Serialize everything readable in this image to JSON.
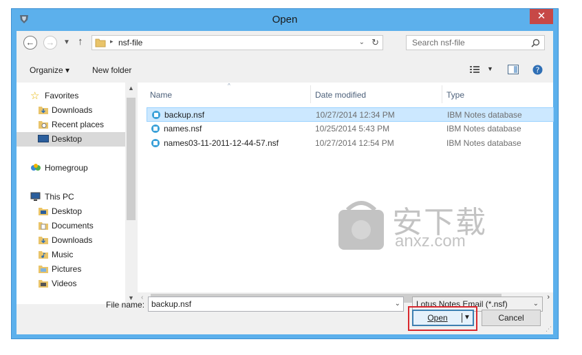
{
  "window": {
    "title": "Open",
    "close_glyph": "✕"
  },
  "address": {
    "folder": "nsf-file",
    "search_placeholder": "Search nsf-file"
  },
  "toolbar": {
    "organize": "Organize ▾",
    "new_folder": "New folder"
  },
  "nav": {
    "items": [
      {
        "label": "Favorites",
        "icon": "star-icon"
      },
      {
        "label": "Downloads",
        "icon": "downloads-folder-icon"
      },
      {
        "label": "Recent places",
        "icon": "recent-places-icon"
      },
      {
        "label": "Desktop",
        "icon": "desktop-icon",
        "selected": true
      },
      {
        "label": "Homegroup",
        "icon": "homegroup-icon"
      },
      {
        "label": "This PC",
        "icon": "pc-icon"
      },
      {
        "label": "Desktop",
        "icon": "folder-icon"
      },
      {
        "label": "Documents",
        "icon": "folder-icon"
      },
      {
        "label": "Downloads",
        "icon": "folder-icon"
      },
      {
        "label": "Music",
        "icon": "folder-icon"
      },
      {
        "label": "Pictures",
        "icon": "folder-icon"
      },
      {
        "label": "Videos",
        "icon": "folder-icon"
      }
    ]
  },
  "columns": {
    "name": "Name",
    "date": "Date modified",
    "type": "Type"
  },
  "files": [
    {
      "name": "backup.nsf",
      "date": "10/27/2014 12:34 PM",
      "type": "IBM Notes database",
      "selected": true
    },
    {
      "name": "names.nsf",
      "date": "10/25/2014 5:43 PM",
      "type": "IBM Notes database"
    },
    {
      "name": "names03-11-2011-12-44-57.nsf",
      "date": "10/27/2014 12:54 PM",
      "type": "IBM Notes database"
    }
  ],
  "bottom": {
    "file_name_label": "File name:",
    "file_name_value": "backup.nsf",
    "filter": "Lotus Notes Email (*.nsf)",
    "open": "Open",
    "cancel": "Cancel"
  },
  "watermark": {
    "text_cn": "安下载",
    "text_en": "anxz.com"
  },
  "colors": {
    "accent": "#5cb0ec",
    "selection": "#cce8ff",
    "highlight_box": "#d9262c"
  }
}
